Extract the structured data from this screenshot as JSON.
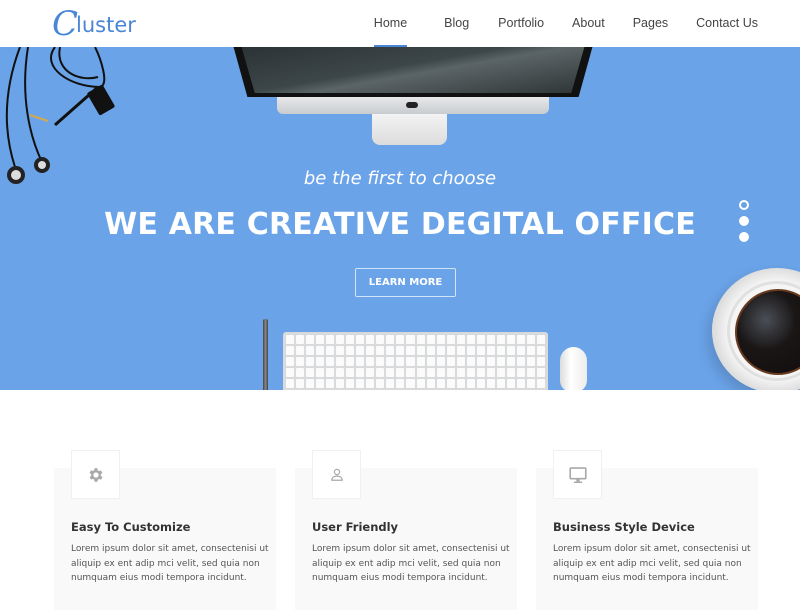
{
  "header": {
    "logo": {
      "initial": "C",
      "rest": "luster"
    },
    "nav": [
      {
        "label": "Home",
        "active": true
      },
      {
        "label": "Blog",
        "active": false
      },
      {
        "label": "Portfolio",
        "active": false
      },
      {
        "label": "About",
        "active": false
      },
      {
        "label": "Pages",
        "active": false
      },
      {
        "label": "Contact Us",
        "active": false
      }
    ]
  },
  "hero": {
    "subtitle": "be the first to choose",
    "title": "WE ARE CREATIVE DEGITAL OFFICE",
    "button_label": "LEARN MORE",
    "slides_count": 3,
    "active_slide": 1,
    "background_color": "#6aa3e8"
  },
  "features": [
    {
      "icon": "gear-icon",
      "title": "Easy To Customize",
      "text": "Lorem ipsum dolor sit amet, consectenisi ut aliquip ex ent adip mci velit, sed quia non numquam eius modi tempora incidunt."
    },
    {
      "icon": "user-icon",
      "title": "User Friendly",
      "text": "Lorem ipsum dolor sit amet, consectenisi ut aliquip ex ent adip mci velit, sed quia non numquam eius modi tempora incidunt."
    },
    {
      "icon": "monitor-icon",
      "title": "Business Style Device",
      "text": "Lorem ipsum dolor sit amet, consectenisi ut aliquip ex ent adip mci velit, sed quia non numquam eius modi tempora incidunt."
    }
  ],
  "colors": {
    "accent": "#4a86d6",
    "hero": "#6aa3e8",
    "card_bg": "#f9f9f9"
  }
}
